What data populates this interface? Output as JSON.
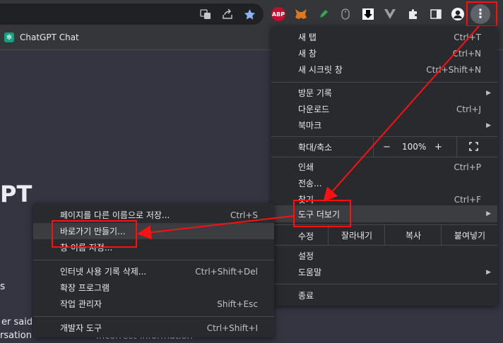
{
  "bookmarks": [
    {
      "label": "ChatGPT Chat"
    }
  ],
  "page": {
    "partial_title": "PT",
    "partial_1": "s",
    "partial_2": "er said",
    "partial_3": "rsation",
    "partial_4": "Incorrect information"
  },
  "toolbar": {
    "extensions": [
      "translate-icon",
      "share-icon",
      "bookmark-star-icon",
      "adblock-icon",
      "metamask-icon",
      "pen-icon",
      "mouse-icon",
      "download-icon",
      "vue-icon",
      "puzzle-icon",
      "sidepanel-icon",
      "profile-icon"
    ],
    "abp_label": "ABP",
    "more_glyph": "⋮"
  },
  "main_menu": {
    "new_tab": {
      "label": "새 탭",
      "shortcut": "Ctrl+T"
    },
    "new_window": {
      "label": "새 창",
      "shortcut": "Ctrl+N"
    },
    "new_incognito": {
      "label": "새 시크릿 창",
      "shortcut": "Ctrl+Shift+N"
    },
    "history": {
      "label": "방문 기록"
    },
    "downloads": {
      "label": "다운로드",
      "shortcut": "Ctrl+J"
    },
    "bookmarks": {
      "label": "북마크"
    },
    "zoom": {
      "label": "확대/축소",
      "minus": "−",
      "value": "100%",
      "plus": "+"
    },
    "print": {
      "label": "인쇄",
      "shortcut": "Ctrl+P"
    },
    "cast": {
      "label": "전송..."
    },
    "find": {
      "label": "찾기",
      "shortcut": "Ctrl+F"
    },
    "more_tools": {
      "label": "도구 더보기"
    },
    "edit": {
      "label": "수정",
      "cut": "잘라내기",
      "copy": "복사",
      "paste": "붙여넣기"
    },
    "settings": {
      "label": "설정"
    },
    "help": {
      "label": "도움말"
    },
    "exit": {
      "label": "종료"
    }
  },
  "submenu": {
    "save_page": {
      "label": "페이지를 다른 이름으로 저장...",
      "shortcut": "Ctrl+S"
    },
    "create_shortcut": {
      "label": "바로가기 만들기..."
    },
    "name_window": {
      "label": "창 이름 지정..."
    },
    "clear_data": {
      "label": "인터넷 사용 기록 삭제...",
      "shortcut": "Ctrl+Shift+Del"
    },
    "extensions": {
      "label": "확장 프로그램"
    },
    "task_manager": {
      "label": "작업 관리자",
      "shortcut": "Shift+Esc"
    },
    "dev_tools": {
      "label": "개발자 도구",
      "shortcut": "Ctrl+Shift+I"
    }
  },
  "annotation_color": "#ff1010"
}
